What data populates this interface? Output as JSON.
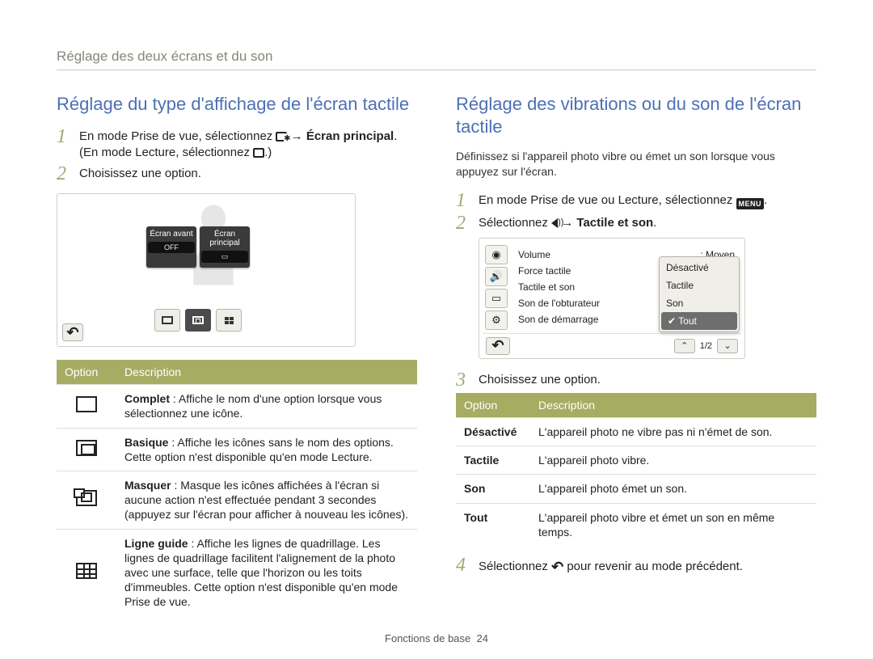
{
  "chapter_title": "Réglage des deux écrans et du son",
  "page_footer_label": "Fonctions de base",
  "page_number": "24",
  "left": {
    "heading": "Réglage du type d'affichage de l'écran tactile",
    "step1_a": "En mode Prise de vue, sélectionnez ",
    "step1_b": " → ",
    "step1_c": "Écran principal",
    "step1_d": ". (En mode Lecture, sélectionnez ",
    "step1_e": ".)",
    "step2": "Choisissez une option.",
    "lcd": {
      "tile_front": "Écran avant",
      "tile_front_badge": "OFF",
      "tile_main": "Écran principal"
    },
    "table_header_option": "Option",
    "table_header_desc": "Description",
    "rows": [
      {
        "icon": "full-icon",
        "label": "Complet",
        "desc": " : Affiche le nom d'une option lorsque vous sélectionnez une icône."
      },
      {
        "icon": "basic-icon",
        "label": "Basique",
        "desc": " : Affiche les icônes sans le nom des options. Cette option n'est disponible qu'en mode Lecture."
      },
      {
        "icon": "mask-icon",
        "label": "Masquer",
        "desc": " : Masque les icônes affichées à l'écran si aucune action n'est effectuée pendant 3 secondes (appuyez sur l'écran pour afficher à nouveau les icônes)."
      },
      {
        "icon": "guide-icon",
        "label": "Ligne guide",
        "desc": " : Affiche les lignes de quadrillage. Les lignes de quadrillage facilitent l'alignement de la photo avec une surface, telle que l'horizon ou les toits d'immeubles. Cette option n'est disponible qu'en mode Prise de vue."
      }
    ]
  },
  "right": {
    "heading": "Réglage des vibrations ou du son de l'écran tactile",
    "intro": "Définissez si l'appareil photo vibre ou émet un son lorsque vous appuyez sur l'écran.",
    "step1_a": "En mode Prise de vue ou Lecture, sélectionnez ",
    "step1_b": ".",
    "step2_a": "Sélectionnez ",
    "step2_b": " → ",
    "step2_c": "Tactile et son",
    "step2_d": ".",
    "lcd2": {
      "rows": [
        {
          "label": "Volume",
          "value": ": Moyen"
        },
        {
          "label": "Force tactile",
          "value": ""
        },
        {
          "label": "Tactile et son",
          "value": ""
        },
        {
          "label": "Son de l'obturateur",
          "value": ""
        },
        {
          "label": "Son de démarrage",
          "value": ""
        }
      ],
      "popup": [
        "Désactivé",
        "Tactile",
        "Son",
        "Tout"
      ],
      "popup_selected_index": 3,
      "page_indicator": "1/2"
    },
    "step3": "Choisissez une option.",
    "table_header_option": "Option",
    "table_header_desc": "Description",
    "rows": [
      {
        "key": "Désactivé",
        "desc": "L'appareil photo ne vibre pas ni n'émet de son."
      },
      {
        "key": "Tactile",
        "desc": "L'appareil photo vibre."
      },
      {
        "key": "Son",
        "desc": "L'appareil photo émet un son."
      },
      {
        "key": "Tout",
        "desc": "L'appareil photo vibre et émet un son en même temps."
      }
    ],
    "step4_a": "Sélectionnez ",
    "step4_b": " pour revenir au mode précédent."
  }
}
